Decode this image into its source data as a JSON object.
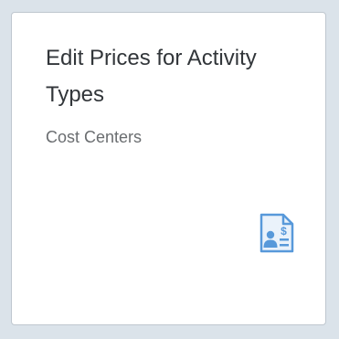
{
  "tile": {
    "title": "Edit Prices for Activity Types",
    "subtitle": "Cost Centers",
    "icon": "employee-pricing-document-icon",
    "icon_symbol": "$"
  },
  "colors": {
    "background": "#dbe3ea",
    "tile_background": "#ffffff",
    "tile_border": "#bfc7cf",
    "title_text": "#32363a",
    "subtitle_text": "#6a6d70",
    "icon": "#5899da"
  }
}
